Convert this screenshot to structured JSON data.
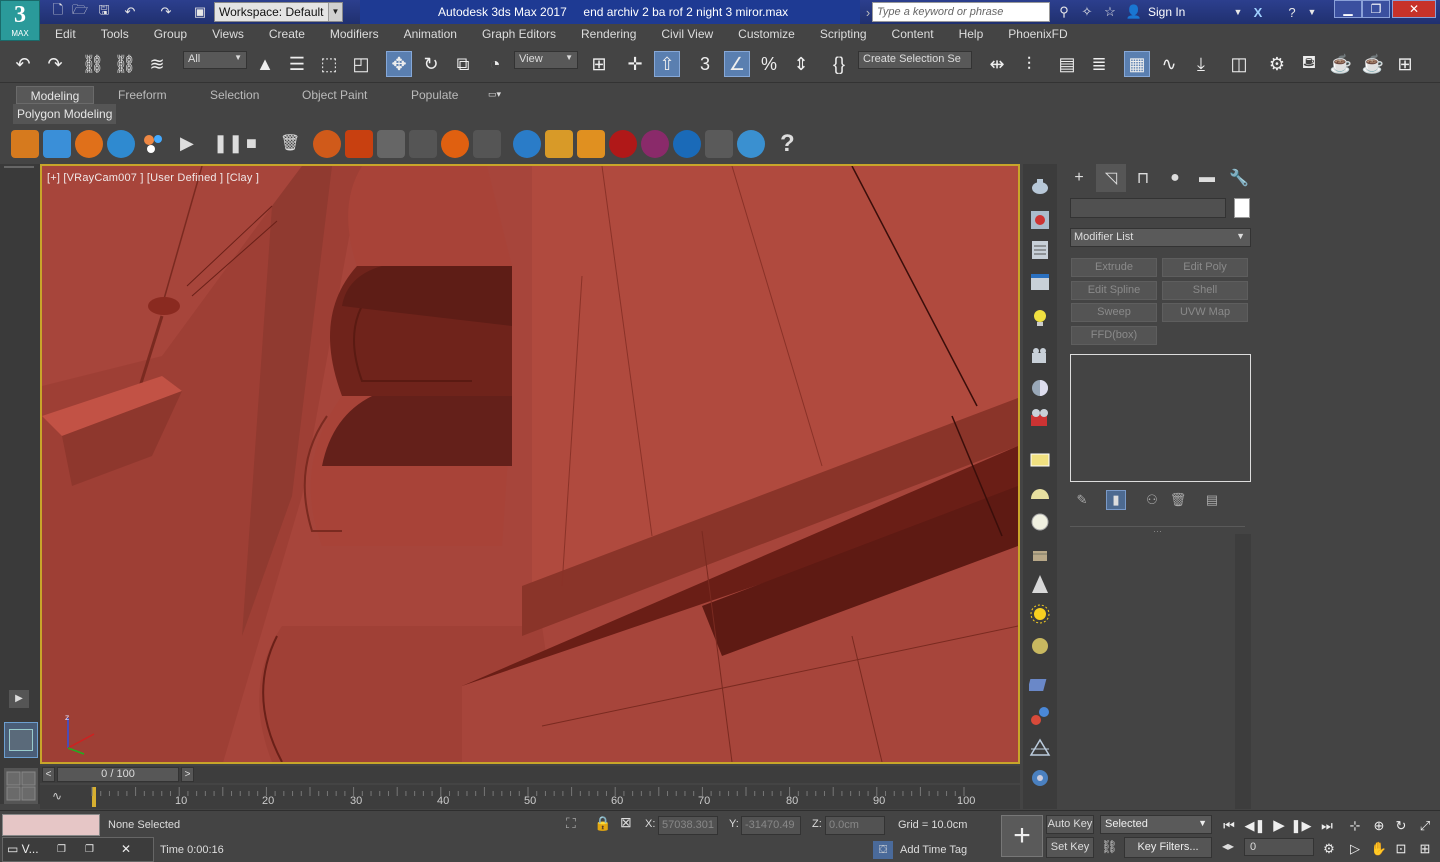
{
  "titlebar": {
    "logo_text": "3",
    "logo_sub": "MAX",
    "workspace": "Workspace: Default",
    "app_title": "Autodesk 3ds Max 2017     end archiv 2 ba rof 2 night 3 miror.max",
    "search_placeholder": "Type a keyword or phrase",
    "sign_in": "Sign In"
  },
  "menu": [
    "Edit",
    "Tools",
    "Group",
    "Views",
    "Create",
    "Modifiers",
    "Animation",
    "Graph Editors",
    "Rendering",
    "Civil View",
    "Customize",
    "Scripting",
    "Content",
    "Help",
    "PhoenixFD"
  ],
  "main_toolbar": {
    "selection_filter": "All",
    "ref_coord": "View",
    "named_selection": "Create Selection Se"
  },
  "ribbon": {
    "tabs": [
      "Modeling",
      "Freeform",
      "Selection",
      "Object Paint",
      "Populate"
    ],
    "active_tab": "Modeling",
    "sub_label": "Polygon Modeling"
  },
  "viewport": {
    "label": "[+] [VRayCam007 ] [User Defined ] [Clay ]",
    "colors": {
      "base": "#a7453b",
      "light": "#b3493e",
      "shadow": "#6a2018",
      "border": "#c8a52a"
    }
  },
  "command_panel": {
    "modifier_list": "Modifier List",
    "modifier_buttons": [
      "Extrude",
      "Edit Poly",
      "Edit Spline",
      "Shell",
      "Sweep",
      "UVW Map",
      "FFD(box)"
    ]
  },
  "timeline": {
    "slider_label": "0 / 100",
    "ticks": [
      "10",
      "20",
      "30",
      "40",
      "50",
      "60",
      "70",
      "80",
      "90",
      "100"
    ]
  },
  "status": {
    "selection": "None Selected",
    "time_label": "Time  0:00:16",
    "x_label": "X:",
    "x_value": "57038.301",
    "y_label": "Y:",
    "y_value": "-31470.49",
    "z_label": "Z:",
    "z_value": "0.0cm",
    "grid": "Grid = 10.0cm",
    "add_time_tag": "Add Time Tag",
    "auto_key": "Auto Key",
    "set_key": "Set Key",
    "key_mode": "Selected",
    "key_filters": "Key Filters...",
    "frame": "0",
    "taskbar_item": "V..."
  }
}
